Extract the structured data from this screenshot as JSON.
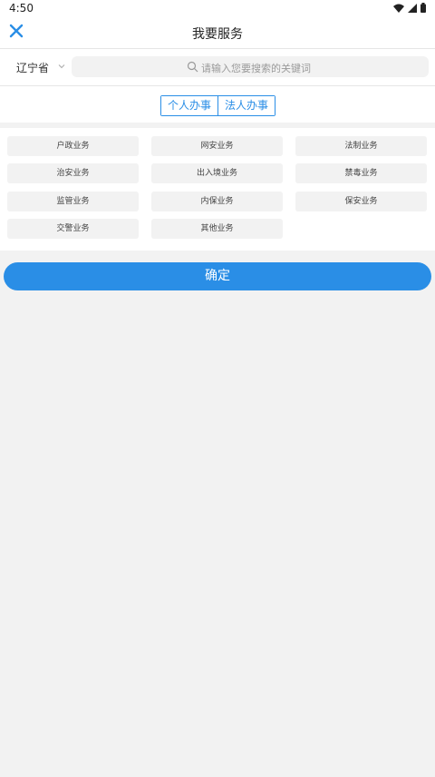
{
  "status_bar": {
    "time": "4:50"
  },
  "header": {
    "title": "我要服务"
  },
  "search": {
    "province": "辽宁省",
    "placeholder": "请输入您要搜索的关键词"
  },
  "tabs": [
    {
      "label": "个人办事",
      "active": true
    },
    {
      "label": "法人办事",
      "active": false
    }
  ],
  "categories": [
    "户政业务",
    "网安业务",
    "法制业务",
    "治安业务",
    "出入境业务",
    "禁毒业务",
    "监管业务",
    "内保业务",
    "保安业务",
    "交警业务",
    "其他业务"
  ],
  "confirm_label": "确定",
  "colors": {
    "accent": "#2a8ee6",
    "background": "#f2f2f2",
    "chip": "#f2f2f2"
  }
}
